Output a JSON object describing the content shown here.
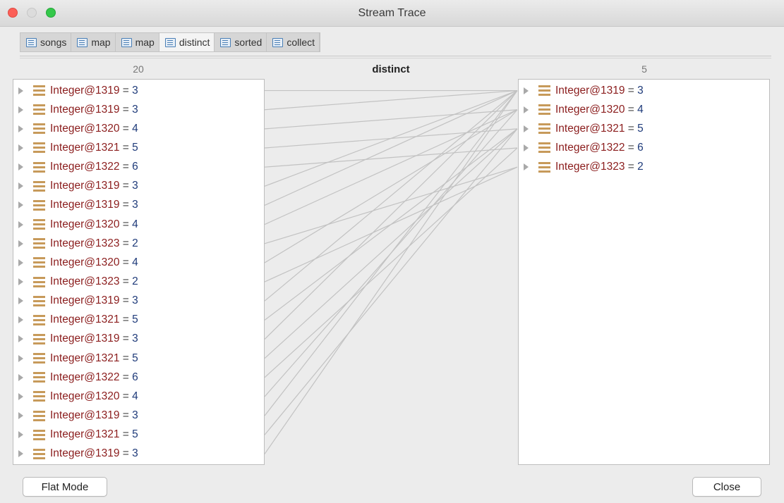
{
  "window": {
    "title": "Stream Trace"
  },
  "tabs": [
    {
      "label": "songs",
      "active": false
    },
    {
      "label": "map",
      "active": false
    },
    {
      "label": "map",
      "active": false
    },
    {
      "label": "distinct",
      "active": true
    },
    {
      "label": "sorted",
      "active": false
    },
    {
      "label": "collect",
      "active": false
    }
  ],
  "columns": {
    "left_count": "20",
    "operation": "distinct",
    "right_count": "5"
  },
  "left_items": [
    {
      "name": "Integer@1319",
      "eq": "=",
      "value": "3"
    },
    {
      "name": "Integer@1319",
      "eq": "=",
      "value": "3"
    },
    {
      "name": "Integer@1320",
      "eq": "=",
      "value": "4"
    },
    {
      "name": "Integer@1321",
      "eq": "=",
      "value": "5"
    },
    {
      "name": "Integer@1322",
      "eq": "=",
      "value": "6"
    },
    {
      "name": "Integer@1319",
      "eq": "=",
      "value": "3"
    },
    {
      "name": "Integer@1319",
      "eq": "=",
      "value": "3"
    },
    {
      "name": "Integer@1320",
      "eq": "=",
      "value": "4"
    },
    {
      "name": "Integer@1323",
      "eq": "=",
      "value": "2"
    },
    {
      "name": "Integer@1320",
      "eq": "=",
      "value": "4"
    },
    {
      "name": "Integer@1323",
      "eq": "=",
      "value": "2"
    },
    {
      "name": "Integer@1319",
      "eq": "=",
      "value": "3"
    },
    {
      "name": "Integer@1321",
      "eq": "=",
      "value": "5"
    },
    {
      "name": "Integer@1319",
      "eq": "=",
      "value": "3"
    },
    {
      "name": "Integer@1321",
      "eq": "=",
      "value": "5"
    },
    {
      "name": "Integer@1322",
      "eq": "=",
      "value": "6"
    },
    {
      "name": "Integer@1320",
      "eq": "=",
      "value": "4"
    },
    {
      "name": "Integer@1319",
      "eq": "=",
      "value": "3"
    },
    {
      "name": "Integer@1321",
      "eq": "=",
      "value": "5"
    },
    {
      "name": "Integer@1319",
      "eq": "=",
      "value": "3"
    }
  ],
  "right_items": [
    {
      "name": "Integer@1319",
      "eq": "=",
      "value": "3"
    },
    {
      "name": "Integer@1320",
      "eq": "=",
      "value": "4"
    },
    {
      "name": "Integer@1321",
      "eq": "=",
      "value": "5"
    },
    {
      "name": "Integer@1322",
      "eq": "=",
      "value": "6"
    },
    {
      "name": "Integer@1323",
      "eq": "=",
      "value": "2"
    }
  ],
  "buttons": {
    "flat_mode": "Flat Mode",
    "close": "Close"
  },
  "colors": {
    "name_text": "#8b1d1d",
    "value_text": "#1f3b7a",
    "icon": "#c79a5a",
    "tab_icon": "#4a7fb5"
  },
  "icons": {
    "tab": "document-icon",
    "item": "field-list-icon",
    "expand": "disclosure-triangle-icon"
  }
}
